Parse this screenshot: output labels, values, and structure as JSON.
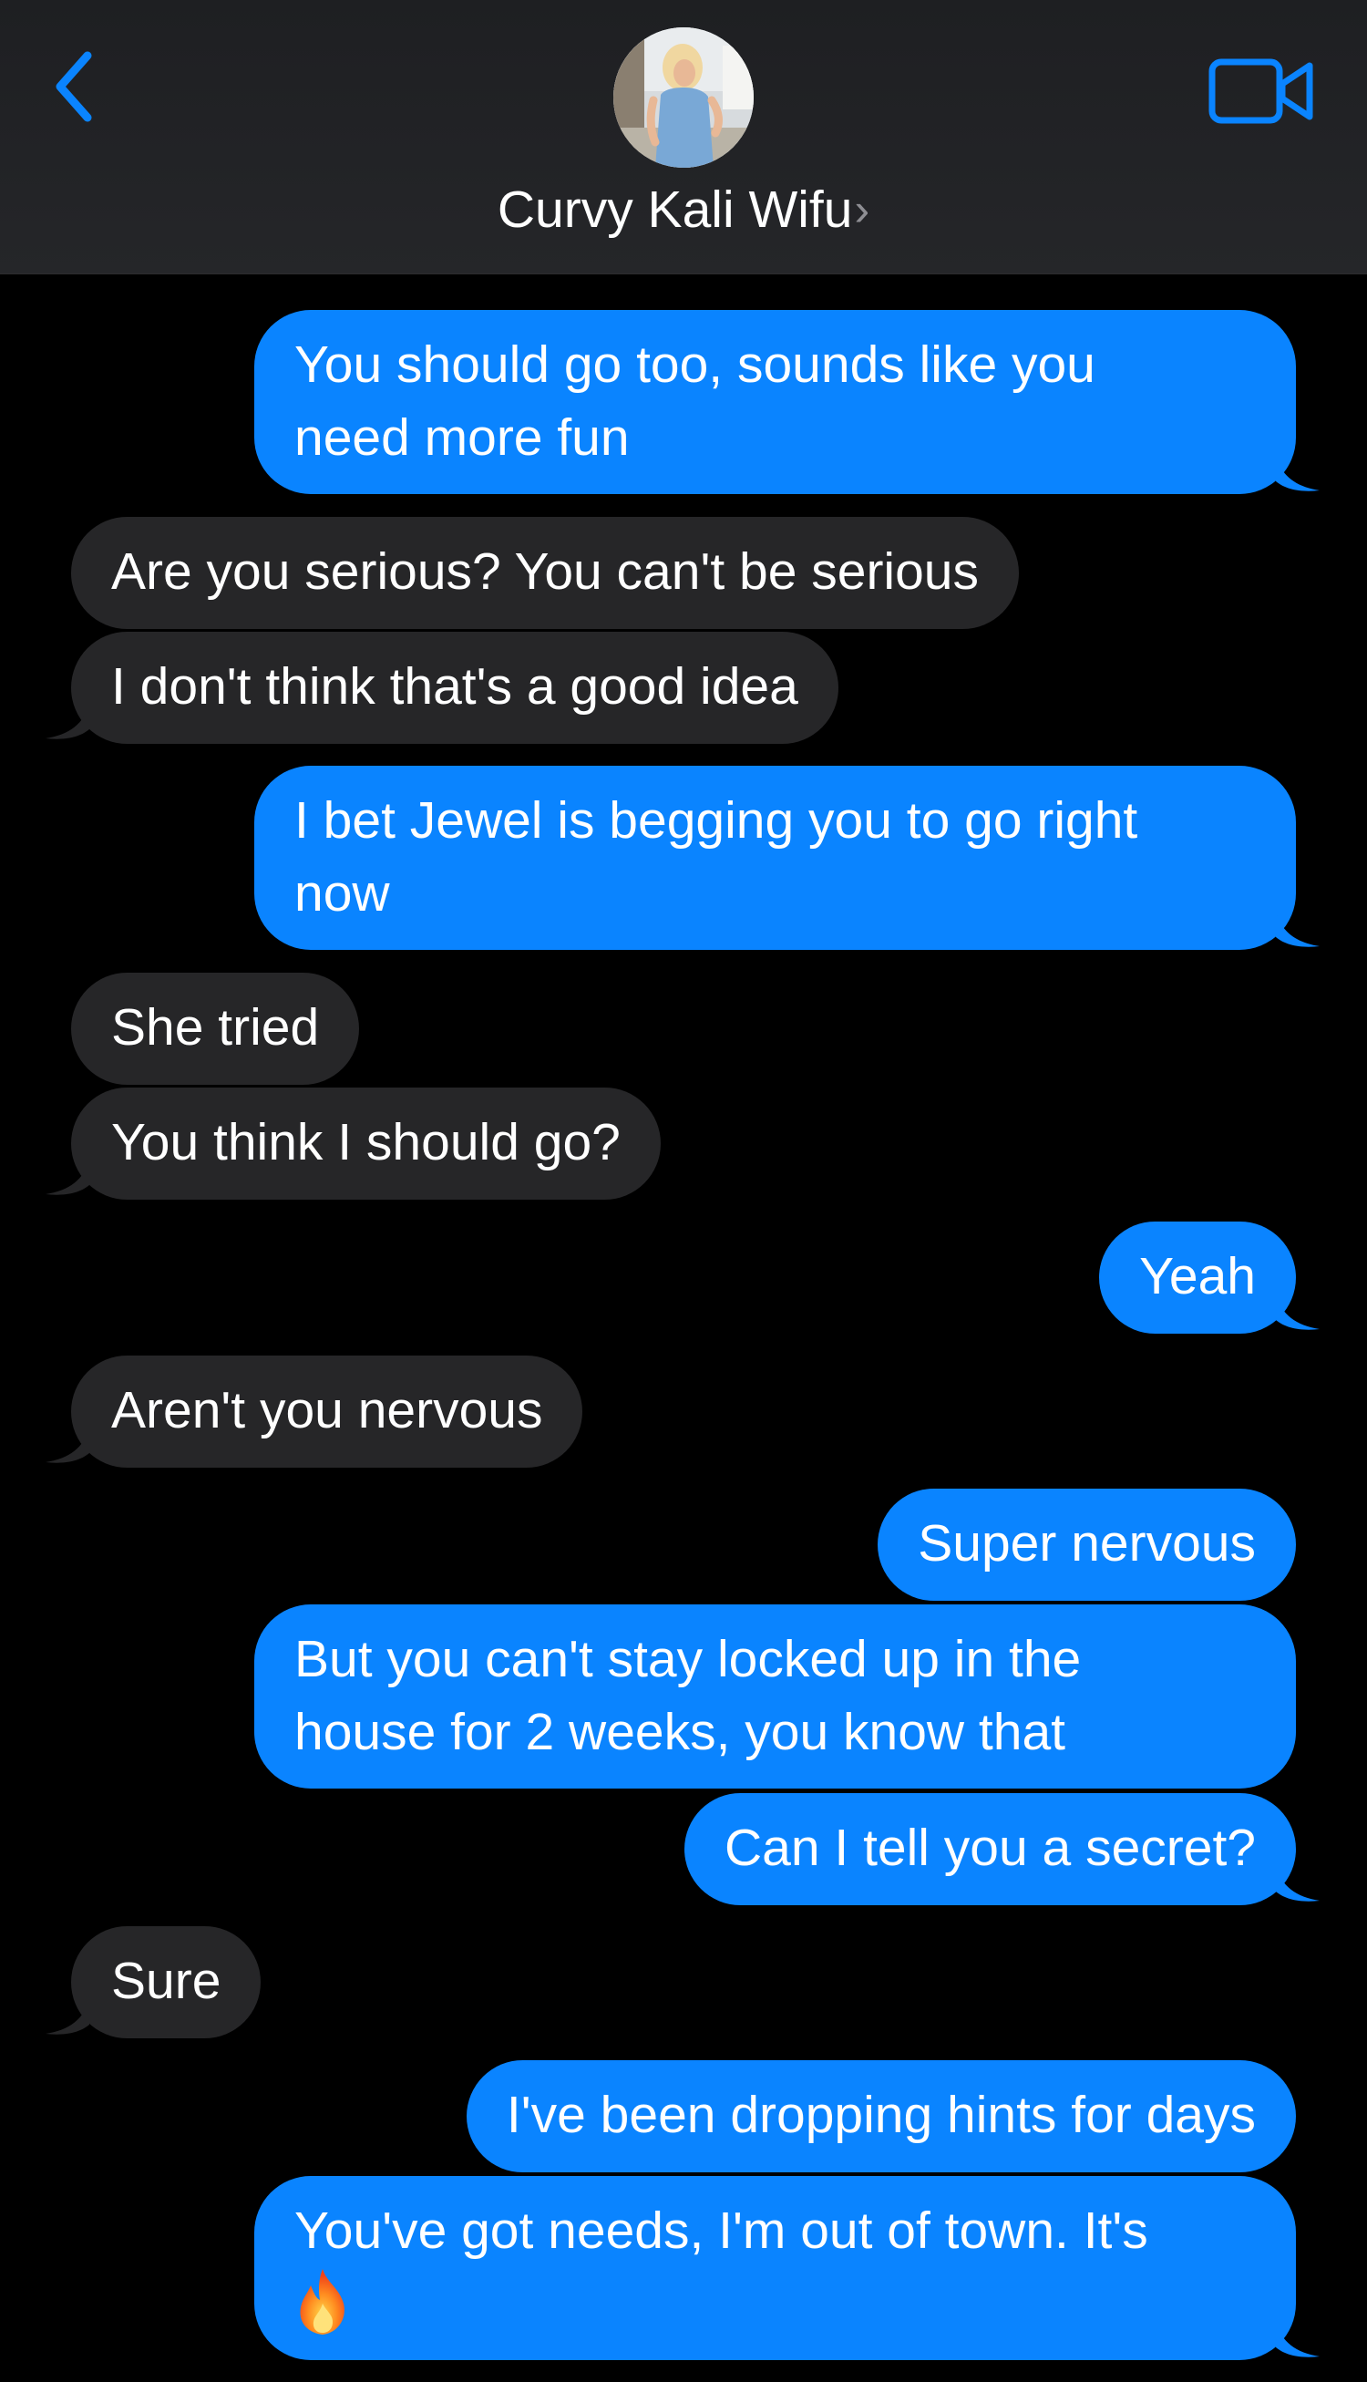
{
  "header": {
    "contact_name": "Curvy Kali Wifu",
    "chevron": "›",
    "back_icon": "chevron-left-icon",
    "video_icon": "video-camera-icon",
    "accent_color": "#0a84ff"
  },
  "colors": {
    "outgoing_bubble": "#0a84ff",
    "incoming_bubble": "#262628",
    "background": "#000000"
  },
  "messages": [
    {
      "dir": "out",
      "lines": [
        "You should go too, sounds like you",
        "need more fun"
      ]
    },
    {
      "dir": "in",
      "lines": [
        "Are you serious? You can't be serious"
      ]
    },
    {
      "dir": "in",
      "lines": [
        "I don't think that's a good idea"
      ]
    },
    {
      "dir": "out",
      "lines": [
        "I bet Jewel is begging you to go right",
        "now"
      ]
    },
    {
      "dir": "in",
      "lines": [
        "She tried"
      ]
    },
    {
      "dir": "in",
      "lines": [
        "You think I should go?"
      ]
    },
    {
      "dir": "out",
      "lines": [
        "Yeah"
      ]
    },
    {
      "dir": "in",
      "lines": [
        "Aren't you nervous"
      ]
    },
    {
      "dir": "out",
      "lines": [
        "Super nervous"
      ]
    },
    {
      "dir": "out",
      "lines": [
        "But you can't stay locked up in the",
        "house for 2 weeks, you know that"
      ]
    },
    {
      "dir": "out",
      "lines": [
        "Can I tell you a secret?"
      ]
    },
    {
      "dir": "in",
      "lines": [
        "Sure"
      ]
    },
    {
      "dir": "out",
      "lines": [
        "I've been dropping hints for days"
      ]
    },
    {
      "dir": "out",
      "lines": [
        "You've got needs, I'm out of town. It's",
        ""
      ],
      "emoji": "fire-emoji-icon"
    }
  ]
}
